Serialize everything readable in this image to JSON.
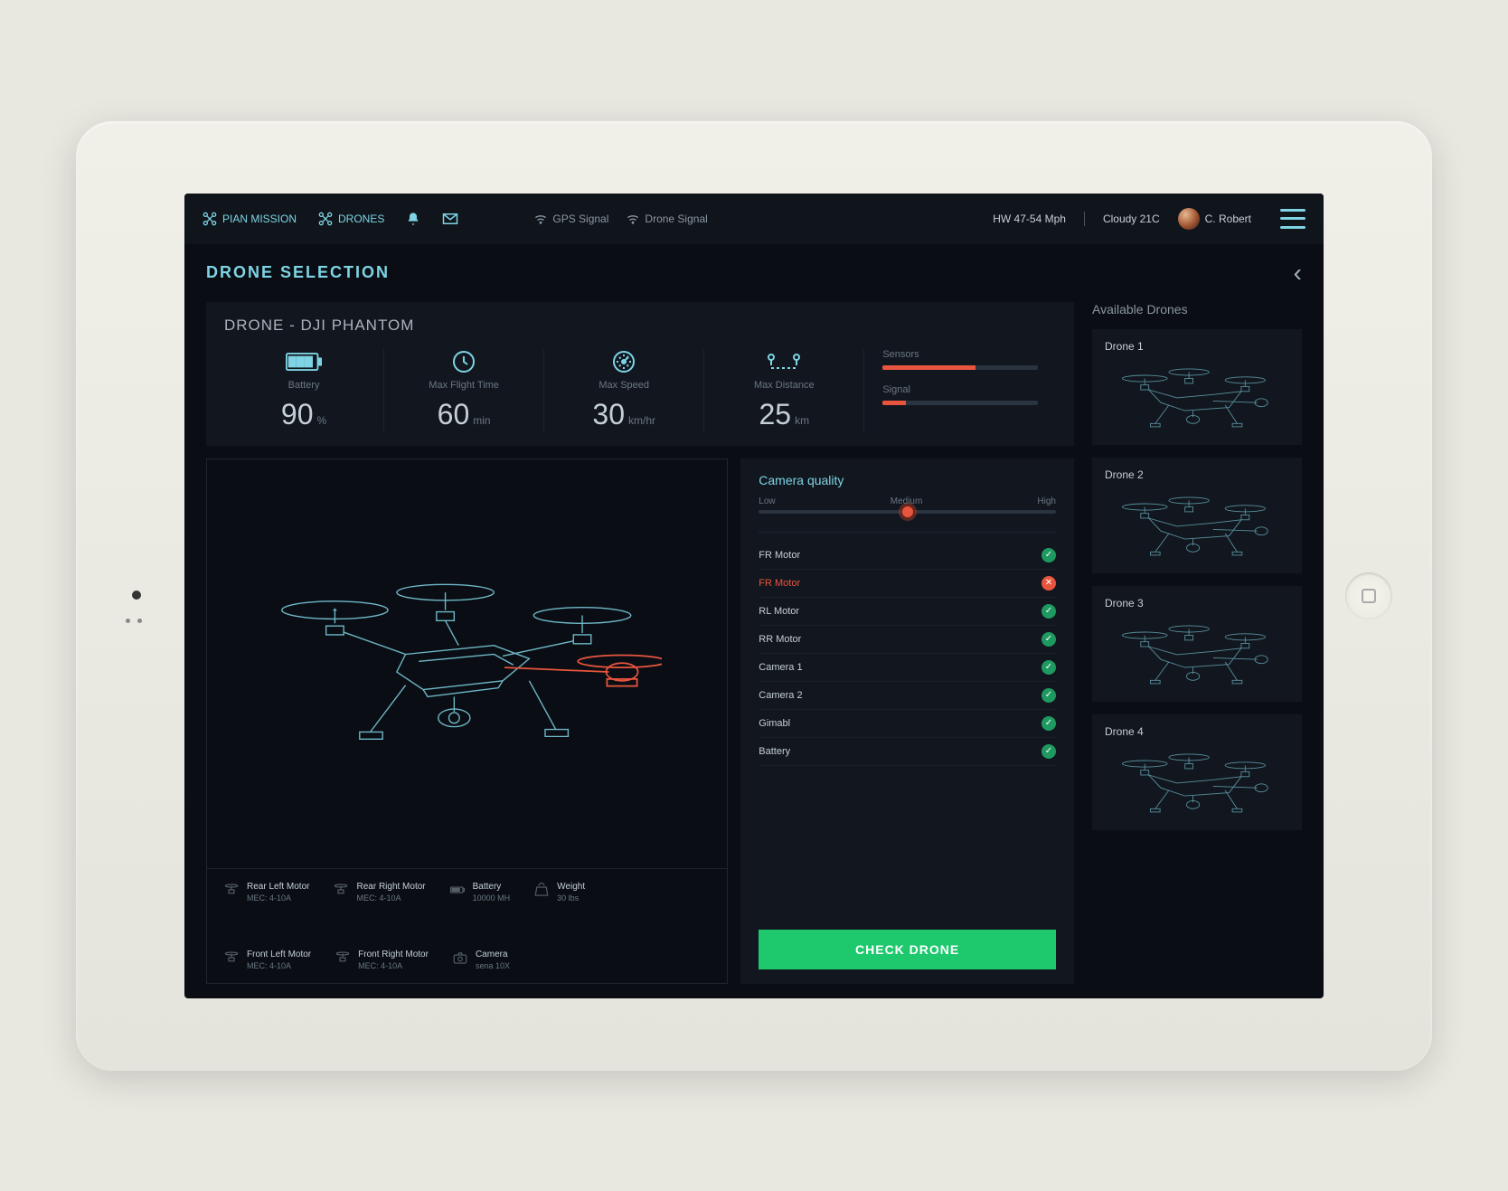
{
  "header": {
    "nav": {
      "plan_mission": "PIAN MISSION",
      "drones": "DRONES"
    },
    "center": {
      "gps": "GPS Signal",
      "drone_signal": "Drone Signal"
    },
    "weather": "HW 47-54 Mph",
    "weather2": "Cloudy  21C",
    "user_name": "C. Robert"
  },
  "page_title": "DRONE SELECTION",
  "main_drone": {
    "title": "DRONE - DJI PHANTOM",
    "stats": {
      "battery": {
        "label": "Battery",
        "value": "90",
        "unit": "%"
      },
      "flight_time": {
        "label": "Max Flight Time",
        "value": "60",
        "unit": "min"
      },
      "max_speed": {
        "label": "Max Speed",
        "value": "30",
        "unit": "km/hr"
      },
      "max_distance": {
        "label": "Max Distance",
        "value": "25",
        "unit": "km"
      }
    },
    "bars": {
      "sensors": {
        "label": "Sensors",
        "pct": 60
      },
      "signal": {
        "label": "Signal",
        "pct": 15
      }
    },
    "specs": [
      {
        "label": "Rear Left Motor",
        "sub": "MEC: 4-10A"
      },
      {
        "label": "Rear Right Motor",
        "sub": "MEC: 4-10A"
      },
      {
        "label": "Battery",
        "sub": "10000 MH"
      },
      {
        "label": "Weight",
        "sub": "30 lbs"
      },
      {
        "label": "Front Left Motor",
        "sub": "MEC: 4-10A"
      },
      {
        "label": "Front Right Motor",
        "sub": "MEC: 4-10A"
      },
      {
        "label": "Camera",
        "sub": "sena 10X"
      }
    ]
  },
  "camera": {
    "title": "Camera quality",
    "slider": {
      "low": "Low",
      "mid": "Medium",
      "high": "High"
    },
    "checks": [
      {
        "label": "FR Motor",
        "ok": true
      },
      {
        "label": "FR Motor",
        "ok": false
      },
      {
        "label": "RL Motor",
        "ok": true
      },
      {
        "label": "RR Motor",
        "ok": true
      },
      {
        "label": "Camera 1",
        "ok": true
      },
      {
        "label": "Camera 2",
        "ok": true
      },
      {
        "label": "Gimabl",
        "ok": true
      },
      {
        "label": "Battery",
        "ok": true
      }
    ],
    "button": "CHECK DRONE"
  },
  "side": {
    "title": "Available Drones",
    "items": [
      "Drone 1",
      "Drone 2",
      "Drone 3",
      "Drone 4"
    ]
  }
}
